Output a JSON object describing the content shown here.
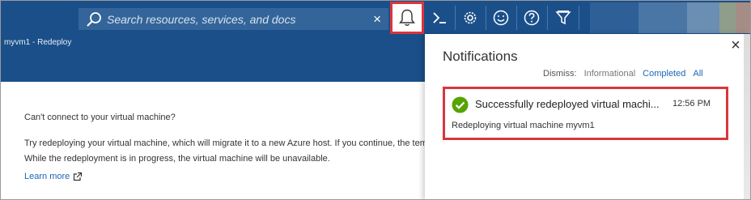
{
  "topbar": {
    "search_placeholder": "Search resources, services, and docs",
    "search_clear": "×",
    "buttons": [
      {
        "name": "bell",
        "icon": "bell-icon"
      },
      {
        "name": "cloud-shell",
        "icon": "cloud-shell-icon"
      },
      {
        "name": "settings",
        "icon": "gear-icon"
      },
      {
        "name": "feedback",
        "icon": "smiley-icon"
      },
      {
        "name": "help",
        "icon": "help-icon"
      },
      {
        "name": "directory-filter",
        "icon": "directory-filter-icon"
      }
    ],
    "user_colors": [
      "#6d8bb0",
      "#8aa4c4",
      "#a9a8a3",
      "#7a9471",
      "#b7a29a"
    ]
  },
  "breadcrumb": "myvm1 - Redeploy",
  "content": {
    "question": "Can't connect to your virtual machine?",
    "description": "Try redeploying your virtual machine, which will migrate it to a new Azure host. If you continue, the temporary drive. While the redeployment is in progress, the virtual machine will be unavailable.",
    "learn_more": "Learn more"
  },
  "panel": {
    "title": "Notifications",
    "close": "×",
    "dismiss_label": "Dismiss:",
    "dismiss_options": [
      "Informational",
      "Completed",
      "All"
    ],
    "notification": {
      "title": "Successfully redeployed virtual machi...",
      "time": "12:56 PM",
      "body": "Redeploying virtual machine myvm1",
      "status_color": "#57a300"
    }
  },
  "colors": {
    "topbar": "#1b4f8a",
    "highlight": "#d9363e",
    "link": "#1a66b8"
  }
}
